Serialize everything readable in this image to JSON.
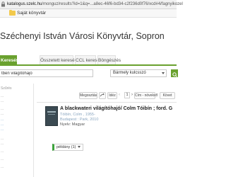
{
  "browser": {
    "url_host": "katalogus.szelc.hu",
    "url_path": "/monguz/results?id=1&q=...a8ec-46f6-bd34-c2f236d0f76/xcd#4/fagnyikozel",
    "bookmark_label": "Saját könyvtár"
  },
  "header": {
    "title": "Széchenyi István Városi Könyvtár, Sopron"
  },
  "tabs": [
    {
      "label": "Keresés",
      "active": true
    },
    {
      "label": "Összetett keresés",
      "active": false
    },
    {
      "label": "CCL keresés",
      "active": false
    },
    {
      "label": "Böngészés",
      "active": false
    }
  ],
  "search": {
    "value": "tben világítóhajó",
    "field": "Bármely kulcsszó"
  },
  "sidebar": {
    "texts": [
      "Szűrés",
      "...",
      "...",
      "...",
      "...",
      "...",
      "...",
      "...",
      "...",
      "..."
    ],
    "links": [
      "...",
      "...",
      "..."
    ]
  },
  "toolbar": {
    "relevance_label": "Megosztás",
    "cite_label": "Idéz",
    "sort_label": "Cím - növekvő",
    "page": "1",
    "next_label": "Követ"
  },
  "result": {
    "title": "A blackwateri világítóhajó/ Colm Tóibín ; ford. G",
    "author": "Tóibín, Colm , 1955-",
    "place": "Budapest : Park, 2010",
    "language": "Nyelv: Magyar",
    "availability": "példány (1)"
  },
  "colors": {
    "accent": "#6aa12f",
    "available": "#3ca33c"
  }
}
